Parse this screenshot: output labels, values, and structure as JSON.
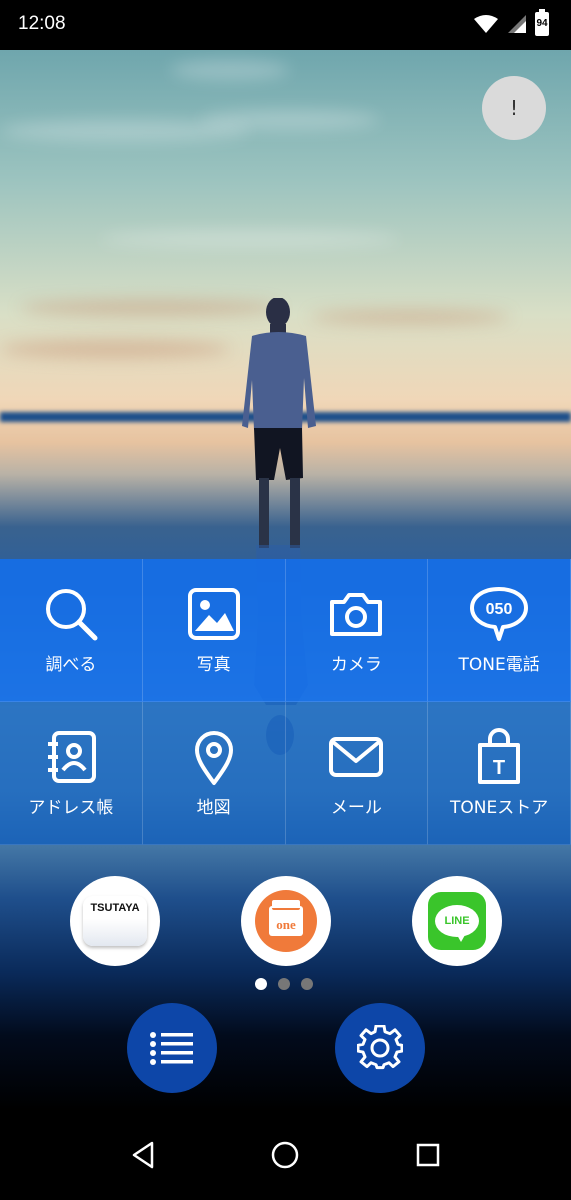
{
  "status_bar": {
    "time": "12:08",
    "battery_level": "94",
    "icons": [
      "wifi-icon",
      "cell-signal-icon",
      "battery-icon"
    ]
  },
  "info_button": {
    "label": "!"
  },
  "tiles": [
    {
      "label": "調べる",
      "icon": "search-icon"
    },
    {
      "label": "写真",
      "icon": "photo-icon"
    },
    {
      "label": "カメラ",
      "icon": "camera-icon"
    },
    {
      "label": "TONE電話",
      "icon": "phone-050-icon",
      "badge": "050"
    },
    {
      "label": "アドレス帳",
      "icon": "address-book-icon"
    },
    {
      "label": "地図",
      "icon": "map-pin-icon"
    },
    {
      "label": "メール",
      "icon": "mail-icon"
    },
    {
      "label": "TONEストア",
      "icon": "store-bag-icon",
      "badge": "T"
    }
  ],
  "dock_apps": [
    {
      "name": "TSUTAYA",
      "icon": "tsutaya-app-icon"
    },
    {
      "name": "one",
      "icon": "one-app-icon"
    },
    {
      "name": "LINE",
      "icon": "line-app-icon"
    }
  ],
  "page_indicator": {
    "current": 1,
    "total": 3
  },
  "bottom_buttons": [
    {
      "icon": "list-icon"
    },
    {
      "icon": "settings-gear-icon"
    }
  ],
  "nav_bar": {
    "buttons": [
      "back-icon",
      "home-icon",
      "recents-icon"
    ]
  },
  "colors": {
    "tile_row1": "#156ee6",
    "tile_row2": "#0c5cbe",
    "round_button": "#0d46a8",
    "line_green": "#3ac52b",
    "one_orange": "#f07a3a"
  }
}
